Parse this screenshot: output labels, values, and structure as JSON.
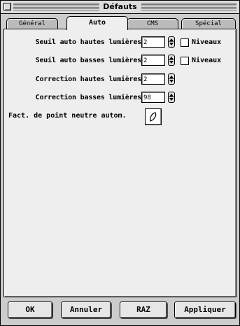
{
  "window": {
    "title": "Défauts"
  },
  "tabs": [
    {
      "label": "Général",
      "active": false
    },
    {
      "label": "Auto",
      "active": true
    },
    {
      "label": "CMS",
      "active": false
    },
    {
      "label": "Spécial",
      "active": false
    }
  ],
  "settings": {
    "seuil_hautes": {
      "label": "Seuil auto hautes lumières",
      "value": "2",
      "checkbox_label": "Niveaux",
      "checked": false
    },
    "seuil_basses": {
      "label": "Seuil auto basses lumières",
      "value": "2",
      "checkbox_label": "Niveaux",
      "checked": false
    },
    "correction_hautes": {
      "label": "Correction hautes lumières",
      "value": "2"
    },
    "correction_basses": {
      "label": "Correction basses lumières",
      "value": "98"
    },
    "point_neutre": {
      "label": "Fact. de point neutre autom.",
      "icon": "eyedropper-icon"
    }
  },
  "buttons": {
    "ok": "OK",
    "cancel": "Annuler",
    "reset": "RAZ",
    "apply": "Appliquer"
  }
}
